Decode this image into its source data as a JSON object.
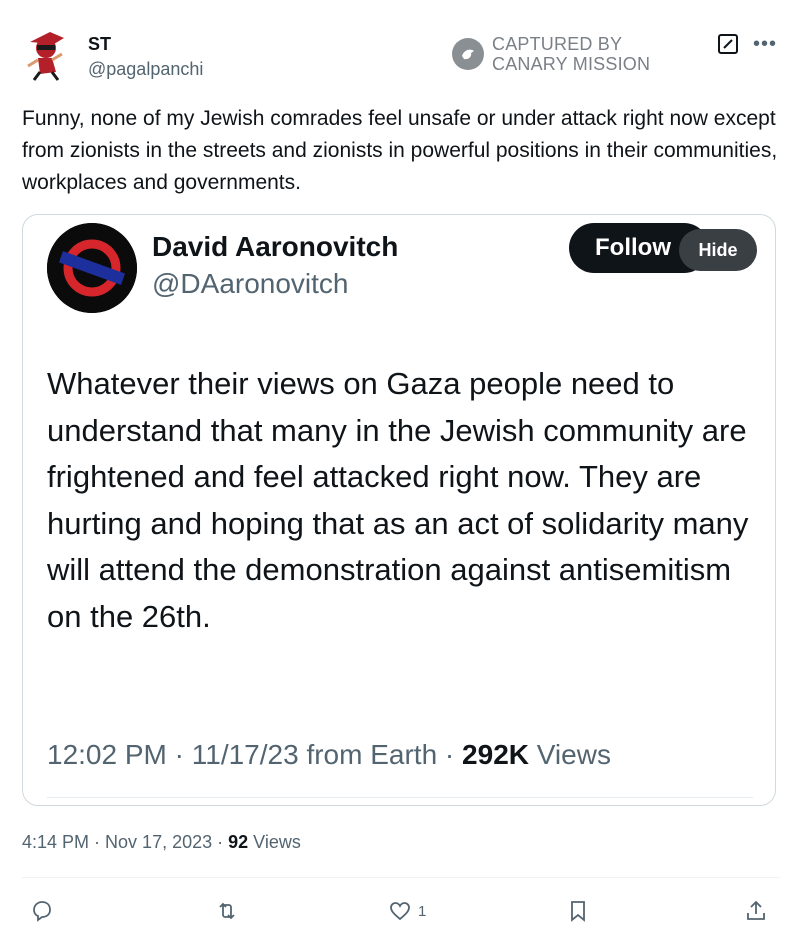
{
  "post": {
    "author_name": "ST",
    "author_handle": "@pagalpanchi",
    "text": "Funny, none of my Jewish comrades feel unsafe or under attack right now except from zionists in the streets and zionists in powerful positions in their communities, workplaces and governments.",
    "time": "4:14 PM",
    "date": "Nov 17, 2023",
    "views_count": "92",
    "views_label": "Views",
    "like_count": "1"
  },
  "watermark": {
    "line1": "CAPTURED BY",
    "line2": "CANARY MISSION"
  },
  "quoted": {
    "name": "David Aaronovitch",
    "handle": "@DAaronovitch",
    "follow_label": "Follow",
    "hide_label": "Hide",
    "text": "Whatever their views on Gaza people need to understand that many in the Jewish community are frightened and feel attacked right now. They are hurting and hoping that as an act of solidarity many will attend the demonstration against antisemitism on the 26th.",
    "time": "12:02 PM",
    "date": "11/17/23",
    "source": "from Earth",
    "views_count": "292K",
    "views_label": "Views"
  },
  "icons": {
    "more": "more-icon",
    "grok": "grok-icon",
    "reply": "reply-icon",
    "retweet": "retweet-icon",
    "like": "like-icon",
    "bookmark": "bookmark-icon",
    "share": "share-icon"
  },
  "colors": {
    "text": "#0f1419",
    "secondary": "#536471",
    "border": "#cfd9de",
    "button": "#0f1419"
  }
}
